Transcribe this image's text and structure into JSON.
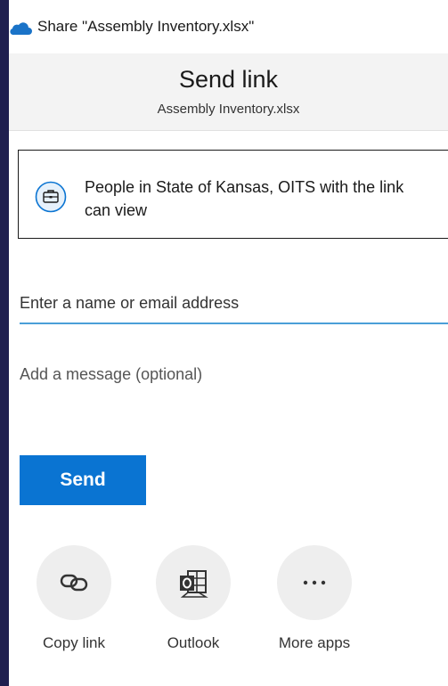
{
  "window": {
    "title": "Share \"Assembly Inventory.xlsx\""
  },
  "header": {
    "title": "Send link",
    "filename": "Assembly Inventory.xlsx"
  },
  "permission": {
    "text": "People in State of Kansas, OITS with the link can view"
  },
  "form": {
    "name_placeholder": "Enter a name or email address",
    "name_value": "",
    "message_placeholder": "Add a message (optional)",
    "message_value": "",
    "send_label": "Send"
  },
  "share_options": [
    {
      "label": "Copy link",
      "icon": "link-icon"
    },
    {
      "label": "Outlook",
      "icon": "outlook-icon"
    },
    {
      "label": "More apps",
      "icon": "more-icon"
    }
  ],
  "colors": {
    "accent": "#0a74d2",
    "input_underline": "#4a9fd8",
    "onedrive": "#1a73c8"
  }
}
